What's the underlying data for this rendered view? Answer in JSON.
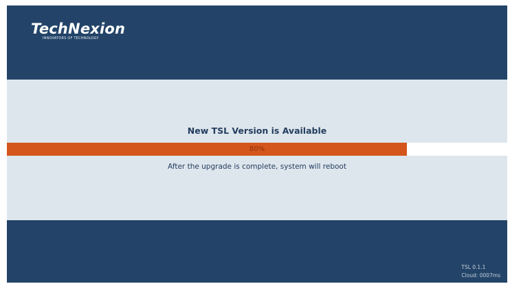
{
  "header": {
    "logo_text": "TechNexion",
    "logo_tagline": "INNOVATORS OF TECHNOLOGY"
  },
  "update": {
    "title": "New TSL Version is Available",
    "progress_percent": 80,
    "progress_label": "80%",
    "message": "After the upgrade is complete, system will reboot"
  },
  "footer": {
    "version": "TSL 0.1.1",
    "cloud": "Cloud: 0007ms"
  },
  "colors": {
    "header_bg": "#234468",
    "body_bg": "#dee6ed",
    "progress_fill": "#d4561d",
    "progress_track": "#ffffff",
    "text_primary": "#233d5e"
  }
}
